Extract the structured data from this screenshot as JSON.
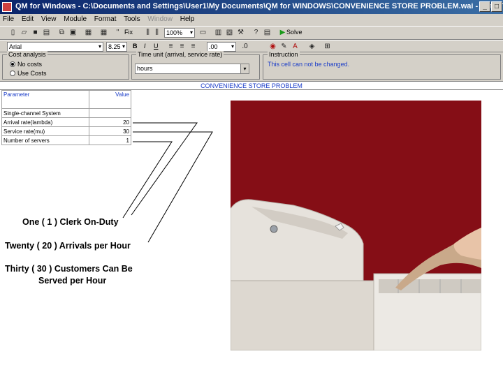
{
  "window": {
    "title": "QM for Windows - C:\\Documents and Settings\\User1\\My Documents\\QM for WINDOWS\\CONVENIENCE STORE PROBLEM.wai - [Data Table]"
  },
  "menu": [
    "File",
    "Edit",
    "View",
    "Module",
    "Format",
    "Tools",
    "Window",
    "Help"
  ],
  "toolbar": {
    "zoom": "100%",
    "solve_label": "Solve",
    "font_name": "Arial",
    "font_size": "8.25",
    "decimals": ".00",
    "bold": "B",
    "italic": "I",
    "underline": "U",
    "fix": "Fix",
    "timeunit_caption": "Time unit (arrival, service rate)"
  },
  "options": {
    "cost_analysis_label": "Cost analysis",
    "radio_no_costs": "No costs",
    "radio_use_costs": "Use Costs",
    "time_unit_label": "Time unit (arrival, service rate)",
    "time_unit_value": "hours",
    "instruction_label": "Instruction",
    "instruction_text": "This cell can not be changed."
  },
  "table": {
    "caption": "CONVENIENCE STORE PROBLEM",
    "col_parameter": "Parameter",
    "col_value": "Value",
    "rows": [
      {
        "param": "Single-channel System",
        "value": ""
      },
      {
        "param": "Arrival rate(lambda)",
        "value": "20"
      },
      {
        "param": "Service rate(mu)",
        "value": "30"
      },
      {
        "param": "Number of servers",
        "value": "1"
      }
    ]
  },
  "annotations": {
    "clerk": "One ( 1 ) Clerk On-Duty",
    "arrivals": "Twenty ( 20 ) Arrivals per Hour",
    "served_line1": "Thirty ( 30 ) Customers Can Be",
    "served_line2": "Served per Hour"
  },
  "colors": {
    "photo_background": "#7a0a12",
    "instruction_text": "#1a3cc8"
  }
}
